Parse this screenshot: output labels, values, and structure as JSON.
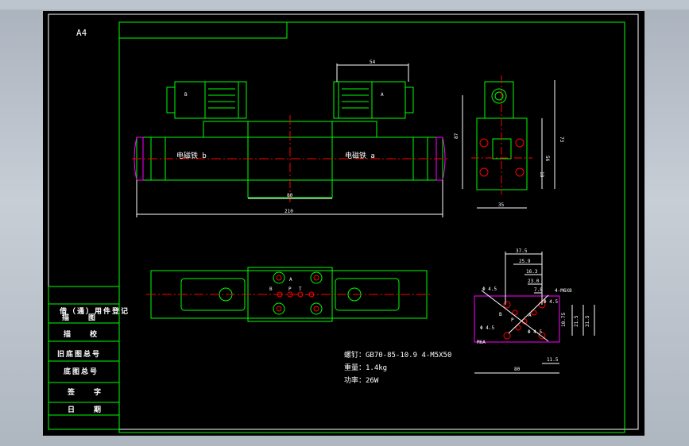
{
  "sheet": {
    "size_label": "A4"
  },
  "title_block": {
    "rows": [
      "借（通）用件登记",
      "描　　图",
      "描　　校",
      "旧底图总号",
      "底图总号",
      "签　　字",
      "日　　期"
    ]
  },
  "front_view": {
    "label_b": "B",
    "label_a": "A",
    "solenoid_b": "电磁铁 b",
    "solenoid_a": "电磁铁 a",
    "dim_body": "80",
    "dim_total": "210",
    "dim_coil": "54"
  },
  "side_view": {
    "dim_height": "73",
    "dim_port_a": "56",
    "dim_port_b": "18",
    "dim_overall": "87",
    "dim_width": "35"
  },
  "bottom_view": {
    "port_b": "B",
    "port_a": "A",
    "port_p": "P",
    "port_t": "T"
  },
  "port_pattern": {
    "d1": "37.5",
    "d2": "25.9",
    "d3": "16.3",
    "d4": "23.0",
    "d5": "7.8",
    "d6": "4-M6X8",
    "d7": "Φ 4.5",
    "d8": "Φ 4.5",
    "d9": "Φ 4.5",
    "d10": "Φ 4.5",
    "d11": "B",
    "d12": "P",
    "d13": "A",
    "d14": "10.75",
    "d15": "21.5",
    "d16": "31.5",
    "d17": "M6A",
    "d18": "80",
    "d19": "11.5"
  },
  "notes": {
    "line1": "螺钉：GB70-85-10.9 4-M5X50",
    "line2": "重量：1.4kg",
    "line3": "功率：26W"
  }
}
